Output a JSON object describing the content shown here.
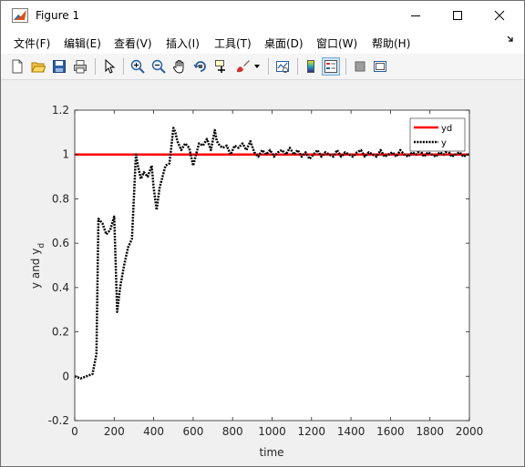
{
  "window": {
    "title": "Figure 1",
    "controls": {
      "minimize": "minimize",
      "maximize": "maximize",
      "close": "close"
    }
  },
  "menu": {
    "items": [
      {
        "label": "文件(F)"
      },
      {
        "label": "编辑(E)"
      },
      {
        "label": "查看(V)"
      },
      {
        "label": "插入(I)"
      },
      {
        "label": "工具(T)"
      },
      {
        "label": "桌面(D)"
      },
      {
        "label": "窗口(W)"
      },
      {
        "label": "帮助(H)"
      }
    ],
    "overflow_icon": "arrow-icon"
  },
  "toolbar": {
    "tools": [
      "new-figure-icon",
      "open-file-icon",
      "save-icon",
      "print-icon",
      "select-arrow-icon",
      "zoom-in-icon",
      "zoom-out-icon",
      "pan-hand-icon",
      "rotate-3d-icon",
      "data-cursor-icon",
      "brush-icon",
      "brush-dropdown-icon",
      "link-plot-icon",
      "colorbar-icon",
      "legend-icon",
      "hide-plot-tools-icon",
      "show-plot-tools-icon"
    ]
  },
  "colors": {
    "yd": "#ff0000",
    "y": "#000000",
    "axes_bg": "#ffffff",
    "figure_bg": "#f0f0f0"
  },
  "chart_data": {
    "type": "line",
    "title": "",
    "xlabel": "time",
    "ylabel": "y and y",
    "ylabel_subscript": "d",
    "xlim": [
      0,
      2000
    ],
    "ylim": [
      -0.2,
      1.2
    ],
    "xticks": [
      0,
      200,
      400,
      600,
      800,
      1000,
      1200,
      1400,
      1600,
      1800,
      2000
    ],
    "yticks": [
      -0.2,
      0,
      0.2,
      0.4,
      0.6,
      0.8,
      1,
      1.2
    ],
    "ytick_labels": [
      "-0.2",
      "0",
      "0.2",
      "0.4",
      "0.6",
      "0.8",
      "1",
      "1.2"
    ],
    "grid": false,
    "legend_position": "top-right",
    "series": [
      {
        "name": "yd",
        "style": "solid",
        "x": [
          0,
          2000
        ],
        "y": [
          1,
          1
        ]
      },
      {
        "name": "y",
        "style": "dotted",
        "x": [
          0,
          30,
          60,
          90,
          110,
          120,
          140,
          160,
          180,
          200,
          215,
          230,
          250,
          270,
          290,
          310,
          320,
          335,
          350,
          370,
          390,
          400,
          415,
          430,
          445,
          460,
          480,
          500,
          510,
          520,
          540,
          560,
          580,
          600,
          615,
          630,
          650,
          670,
          690,
          710,
          720,
          735,
          750,
          770,
          790,
          810,
          830,
          850,
          870,
          890,
          910,
          930,
          950,
          970,
          990,
          1010,
          1030,
          1050,
          1070,
          1090,
          1110,
          1130,
          1150,
          1170,
          1190,
          1210,
          1230,
          1250,
          1270,
          1290,
          1310,
          1330,
          1350,
          1370,
          1390,
          1410,
          1430,
          1450,
          1470,
          1490,
          1510,
          1530,
          1550,
          1570,
          1590,
          1610,
          1630,
          1650,
          1670,
          1690,
          1710,
          1730,
          1750,
          1770,
          1790,
          1810,
          1830,
          1850,
          1870,
          1890,
          1910,
          1930,
          1950,
          1970,
          1990,
          2000
        ],
        "y": [
          0,
          -0.01,
          0,
          0.01,
          0.1,
          0.71,
          0.69,
          0.64,
          0.66,
          0.72,
          0.29,
          0.4,
          0.5,
          0.58,
          0.62,
          1.0,
          0.95,
          0.89,
          0.92,
          0.9,
          0.95,
          0.85,
          0.75,
          0.85,
          0.9,
          0.95,
          0.96,
          1.12,
          1.1,
          1.06,
          1.02,
          1.05,
          1.03,
          0.95,
          1.0,
          1.05,
          1.04,
          1.07,
          1.02,
          1.11,
          1.06,
          1.04,
          1.03,
          1.04,
          1.0,
          1.04,
          1.03,
          1.05,
          1.02,
          1.06,
          1.01,
          0.99,
          1.02,
          1.0,
          1.02,
          0.99,
          1.01,
          1.02,
          1.0,
          1.03,
          1.0,
          1.02,
          0.99,
          1.01,
          0.98,
          1.0,
          1.02,
          0.99,
          1.01,
          1.0,
          0.99,
          1.02,
          0.99,
          1.01,
          1.0,
          0.99,
          1.01,
          1.02,
          0.99,
          1.01,
          1.0,
          0.99,
          1.02,
          0.99,
          1.0,
          1.01,
          0.99,
          1.02,
          1.0,
          0.99,
          1.01,
          1.0,
          1.02,
          0.99,
          1.01,
          1.0,
          0.99,
          1.01,
          1.0,
          1.02,
          0.99,
          1.0,
          1.01,
          0.99,
          1.0,
          1.0
        ]
      }
    ]
  }
}
